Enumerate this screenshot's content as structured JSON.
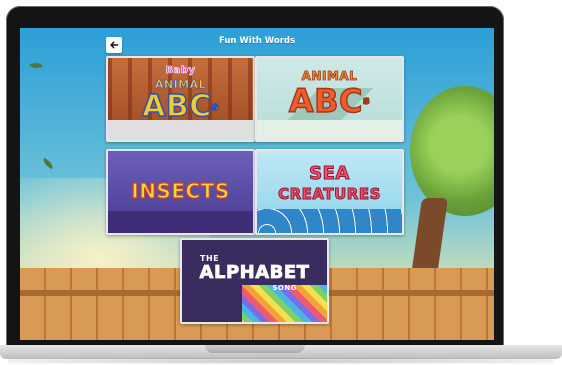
{
  "app": {
    "title": "Fun With Words"
  },
  "cards": [
    {
      "line1": "Baby",
      "line2": "ANIMAL",
      "line3": "ABC",
      "sup": "s"
    },
    {
      "line1": "ANIMAL",
      "line2": "ABC",
      "sup": "s"
    },
    {
      "line1": "INSECTS"
    },
    {
      "line1": "SEA",
      "line2": "CREATURES"
    },
    {
      "line1": "THE",
      "line2": "ALPHABET",
      "line3": "SONG"
    }
  ],
  "colors": {
    "sky_top": "#2c9fd7",
    "title_text": "#ffffff"
  },
  "icons": {
    "back": "arrow-left-icon"
  }
}
